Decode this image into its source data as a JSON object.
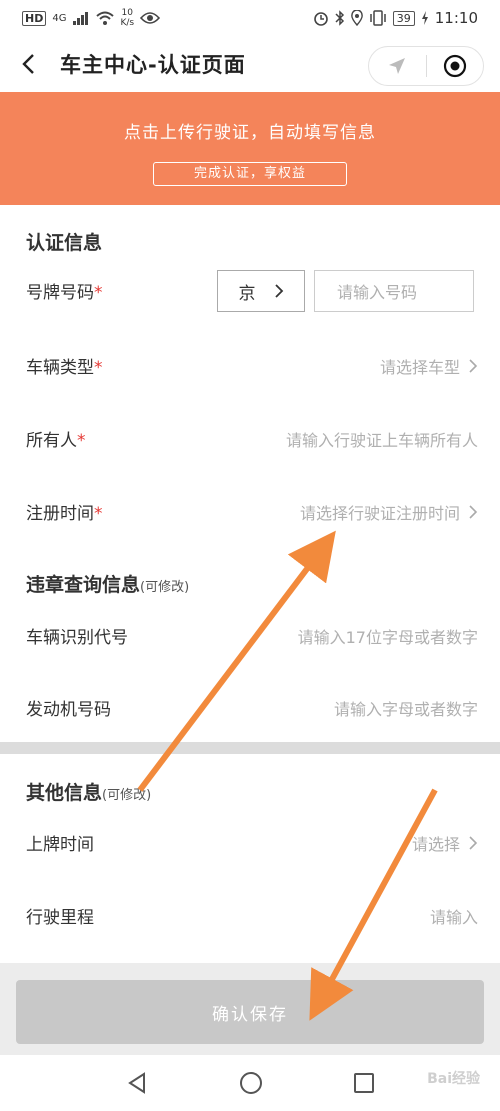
{
  "status_bar": {
    "hd": "HD",
    "network": "4G",
    "speed_value": "10",
    "speed_unit": "K/s",
    "battery": "39",
    "time": "11:10"
  },
  "navbar": {
    "title": "车主中心-认证页面"
  },
  "banner": {
    "text": "点击上传行驶证，自动填写信息",
    "button": "完成认证，享权益"
  },
  "section_cert": {
    "title": "认证信息",
    "rows": {
      "plate": {
        "label": "号牌号码",
        "province": "京",
        "placeholder": "请输入号码"
      },
      "vehicle_type": {
        "label": "车辆类型",
        "value": "请选择车型"
      },
      "owner": {
        "label": "所有人",
        "value": "请输入行驶证上车辆所有人"
      },
      "register_time": {
        "label": "注册时间",
        "value": "请选择行驶证注册时间"
      }
    },
    "required_mark": "*"
  },
  "section_violation": {
    "title": "违章查询信息",
    "note": "(可修改)",
    "rows": {
      "vin": {
        "label": "车辆识别代号",
        "value": "请输入17位字母或者数字"
      },
      "engine": {
        "label": "发动机号码",
        "value": "请输入字母或者数字"
      }
    }
  },
  "section_other": {
    "title": "其他信息",
    "note": "(可修改)",
    "rows": {
      "plate_time": {
        "label": "上牌时间",
        "value": "请选择"
      },
      "mileage": {
        "label": "行驶里程",
        "value": "请输入"
      }
    }
  },
  "save_button": "确认保存",
  "watermark": "Bai经验",
  "colors": {
    "banner": "#f4845a",
    "arrow": "#f28a3c",
    "required": "#e53935",
    "save_disabled": "#c8c8c8"
  }
}
